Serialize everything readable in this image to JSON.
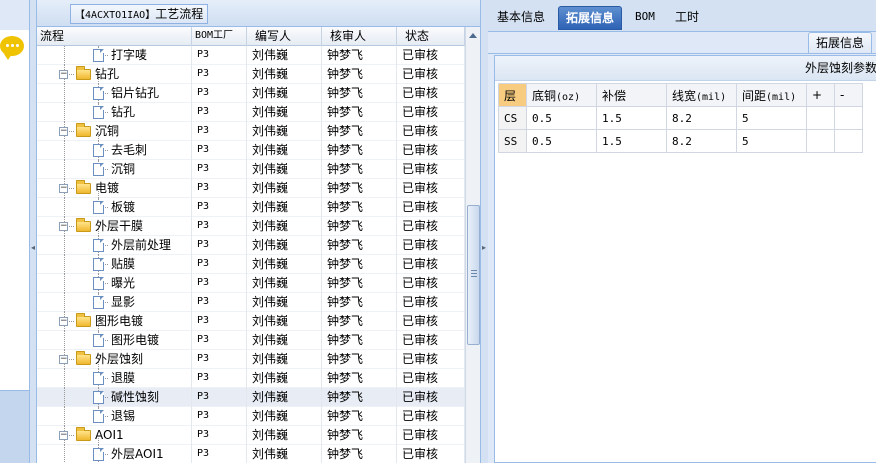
{
  "tree_panel": {
    "title_prefix": "【4ACXTO1IAO】",
    "title_text": "工艺流程",
    "columns": [
      "流程",
      "BOM工厂",
      "编写人",
      "核审人",
      "状态"
    ],
    "rows": [
      {
        "label": "打字唛",
        "type": "leaf",
        "bom": "P3",
        "writer": "刘伟巍",
        "reviewer": "钟梦飞",
        "status": "已审核"
      },
      {
        "label": "钻孔",
        "type": "folder",
        "bom": "P3",
        "writer": "刘伟巍",
        "reviewer": "钟梦飞",
        "status": "已审核"
      },
      {
        "label": "铝片钻孔",
        "type": "leaf",
        "bom": "P3",
        "writer": "刘伟巍",
        "reviewer": "钟梦飞",
        "status": "已审核"
      },
      {
        "label": "钻孔",
        "type": "leaf",
        "bom": "P3",
        "writer": "刘伟巍",
        "reviewer": "钟梦飞",
        "status": "已审核"
      },
      {
        "label": "沉铜",
        "type": "folder",
        "bom": "P3",
        "writer": "刘伟巍",
        "reviewer": "钟梦飞",
        "status": "已审核"
      },
      {
        "label": "去毛刺",
        "type": "leaf",
        "bom": "P3",
        "writer": "刘伟巍",
        "reviewer": "钟梦飞",
        "status": "已审核"
      },
      {
        "label": "沉铜",
        "type": "leaf",
        "bom": "P3",
        "writer": "刘伟巍",
        "reviewer": "钟梦飞",
        "status": "已审核"
      },
      {
        "label": "电镀",
        "type": "folder",
        "bom": "P3",
        "writer": "刘伟巍",
        "reviewer": "钟梦飞",
        "status": "已审核"
      },
      {
        "label": "板镀",
        "type": "leaf",
        "bom": "P3",
        "writer": "刘伟巍",
        "reviewer": "钟梦飞",
        "status": "已审核"
      },
      {
        "label": "外层干膜",
        "type": "folder",
        "bom": "P3",
        "writer": "刘伟巍",
        "reviewer": "钟梦飞",
        "status": "已审核"
      },
      {
        "label": "外层前处理",
        "type": "leaf",
        "bom": "P3",
        "writer": "刘伟巍",
        "reviewer": "钟梦飞",
        "status": "已审核"
      },
      {
        "label": "贴膜",
        "type": "leaf",
        "bom": "P3",
        "writer": "刘伟巍",
        "reviewer": "钟梦飞",
        "status": "已审核"
      },
      {
        "label": "曝光",
        "type": "leaf",
        "bom": "P3",
        "writer": "刘伟巍",
        "reviewer": "钟梦飞",
        "status": "已审核"
      },
      {
        "label": "显影",
        "type": "leaf",
        "bom": "P3",
        "writer": "刘伟巍",
        "reviewer": "钟梦飞",
        "status": "已审核"
      },
      {
        "label": "图形电镀",
        "type": "folder",
        "bom": "P3",
        "writer": "刘伟巍",
        "reviewer": "钟梦飞",
        "status": "已审核"
      },
      {
        "label": "图形电镀",
        "type": "leaf",
        "bom": "P3",
        "writer": "刘伟巍",
        "reviewer": "钟梦飞",
        "status": "已审核"
      },
      {
        "label": "外层蚀刻",
        "type": "folder",
        "bom": "P3",
        "writer": "刘伟巍",
        "reviewer": "钟梦飞",
        "status": "已审核"
      },
      {
        "label": "退膜",
        "type": "leaf",
        "bom": "P3",
        "writer": "刘伟巍",
        "reviewer": "钟梦飞",
        "status": "已审核"
      },
      {
        "label": "碱性蚀刻",
        "type": "leaf",
        "bom": "P3",
        "writer": "刘伟巍",
        "reviewer": "钟梦飞",
        "status": "已审核",
        "selected": true
      },
      {
        "label": "退锡",
        "type": "leaf",
        "bom": "P3",
        "writer": "刘伟巍",
        "reviewer": "钟梦飞",
        "status": "已审核"
      },
      {
        "label": "AOI1",
        "type": "folder",
        "bom": "P3",
        "writer": "刘伟巍",
        "reviewer": "钟梦飞",
        "status": "已审核"
      },
      {
        "label": "外层AOI1",
        "type": "leaf",
        "bom": "P3",
        "writer": "刘伟巍",
        "reviewer": "钟梦飞",
        "status": "已审核"
      }
    ]
  },
  "right_panel": {
    "tabs": [
      {
        "label": "基本信息",
        "active": false
      },
      {
        "label": "拓展信息",
        "active": true
      },
      {
        "label": "BOM",
        "active": false
      },
      {
        "label": "工时",
        "active": false
      }
    ],
    "subtab": "拓展信息",
    "section_title": "外层蚀刻参数",
    "table": {
      "headers": [
        "层",
        "底铜",
        "(oz)",
        "补偿",
        "线宽",
        "(mil)",
        "间距",
        "(mil)",
        "+",
        "-"
      ],
      "rows": [
        {
          "layer": "CS",
          "base_copper": "0.5",
          "compensation": "1.5",
          "line_width": "8.2",
          "spacing": "5"
        },
        {
          "layer": "SS",
          "base_copper": "0.5",
          "compensation": "1.5",
          "line_width": "8.2",
          "spacing": "5"
        }
      ]
    }
  },
  "icons": {
    "chat": "chat-bubble-icon",
    "folder": "folder-icon",
    "document": "document-icon"
  },
  "colors": {
    "active_tab": "#2e63b5",
    "layer_header": "#f7cc80",
    "chat_bubble": "#f0c300"
  }
}
